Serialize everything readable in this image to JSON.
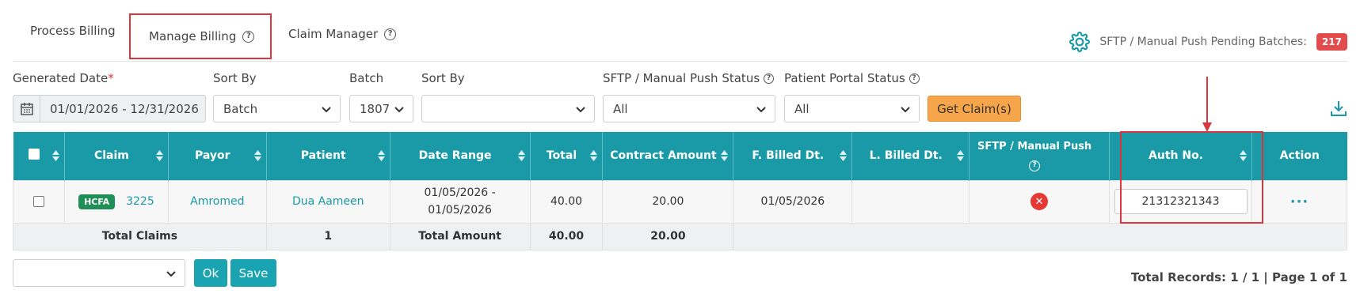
{
  "tabs": [
    {
      "label": "Process Billing"
    },
    {
      "label": "Manage Billing"
    },
    {
      "label": "Claim Manager"
    }
  ],
  "help_glyph": "?",
  "sftp_pending": {
    "label": "SFTP / Manual Push Pending Batches:",
    "count": "217"
  },
  "filters": {
    "generated_date": {
      "label": "Generated Date",
      "required_mark": "*",
      "value": "01/01/2026 - 12/31/2026"
    },
    "sort_by_1": {
      "label": "Sort By",
      "value": "Batch"
    },
    "batch": {
      "label": "Batch",
      "value": "1807"
    },
    "sort_by_2": {
      "label": "Sort By",
      "value": ""
    },
    "sftp_status": {
      "label": "SFTP / Manual Push Status",
      "value": "All"
    },
    "portal_status": {
      "label": "Patient Portal Status",
      "value": "All"
    },
    "get_claims_button": "Get Claim(s)"
  },
  "table": {
    "columns": {
      "claim": "Claim",
      "payor": "Payor",
      "patient": "Patient",
      "date_range": "Date Range",
      "total": "Total",
      "contract_amount": "Contract Amount",
      "f_billed": "F. Billed Dt.",
      "l_billed": "L. Billed Dt.",
      "sftp_push": "SFTP / Manual Push",
      "auth_no": "Auth No.",
      "action": "Action"
    },
    "rows": [
      {
        "claim_type": "HCFA",
        "claim_no": "3225",
        "payor": "Amromed",
        "patient": "Dua Aameen",
        "date_range_start": "01/05/2026 -",
        "date_range_end": "01/05/2026",
        "total": "40.00",
        "contract_amount": "20.00",
        "f_billed": "01/05/2026",
        "l_billed": "",
        "sftp_status_icon": "✕",
        "auth_no": "21312321343",
        "action": "···"
      }
    ],
    "totals": {
      "total_claims_label": "Total Claims",
      "total_claims": "1",
      "total_amount_label": "Total Amount",
      "total": "40.00",
      "contract_amount": "20.00"
    }
  },
  "bottom": {
    "bulk_action_value": "",
    "ok_button": "Ok",
    "save_button": "Save",
    "total_records": "Total Records: 1 / 1 | Page 1 of 1"
  },
  "colors": {
    "accent": "#1a9aa7",
    "highlight_outline": "#d9363e",
    "get_claims": "#f7a54b",
    "pending_badge": "#e24c4c",
    "hcfa_badge": "#1f8f57"
  }
}
